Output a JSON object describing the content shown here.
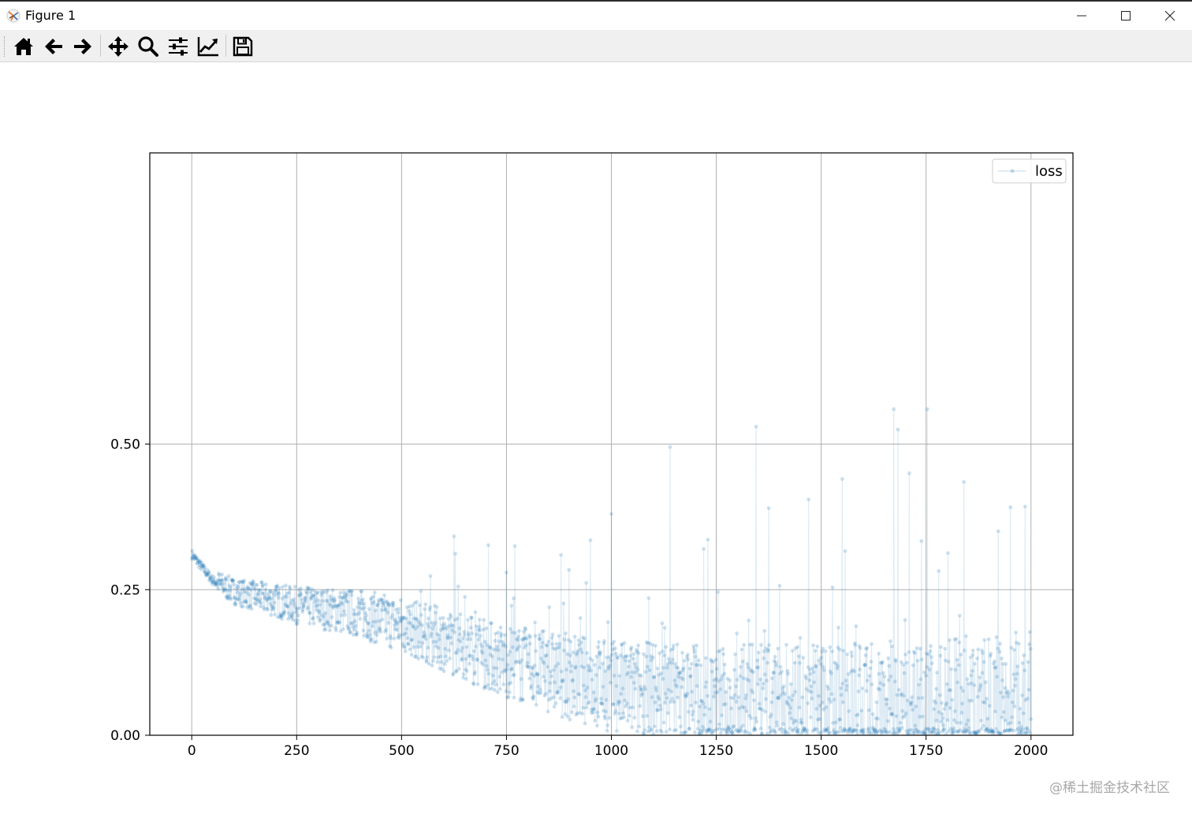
{
  "window": {
    "title": "Figure 1",
    "controls": [
      "minimize",
      "maximize",
      "close"
    ]
  },
  "toolbar": {
    "buttons": [
      {
        "name": "home",
        "icon": "home-icon"
      },
      {
        "name": "back",
        "icon": "arrow-left-icon"
      },
      {
        "name": "forward",
        "icon": "arrow-right-icon"
      },
      {
        "name": "pan",
        "icon": "move-icon"
      },
      {
        "name": "zoom",
        "icon": "magnifier-icon"
      },
      {
        "name": "subplots",
        "icon": "sliders-icon"
      },
      {
        "name": "customize",
        "icon": "line-chart-icon"
      },
      {
        "name": "save",
        "icon": "floppy-icon"
      }
    ]
  },
  "watermark": "@稀土掘金技术社区",
  "chart_data": {
    "type": "line",
    "title": "",
    "xlabel": "",
    "ylabel": "",
    "xlim": [
      -100,
      2100
    ],
    "ylim": [
      0,
      1.0
    ],
    "xticks": [
      "0",
      "250",
      "500",
      "750",
      "1000",
      "1250",
      "1500",
      "1750",
      "2000"
    ],
    "yticks": [
      "0.00",
      "0.25",
      "0.50"
    ],
    "grid": true,
    "legend": {
      "position": "top-right"
    },
    "series": [
      {
        "name": "loss",
        "color": "#1f77b4",
        "marker": "o",
        "alpha": 0.15,
        "n_points": 2001,
        "x_range": [
          0,
          2000
        ],
        "trend_points": [
          {
            "x": 0,
            "y": 0.31
          },
          {
            "x": 50,
            "y": 0.265
          },
          {
            "x": 100,
            "y": 0.245
          },
          {
            "x": 250,
            "y": 0.22
          },
          {
            "x": 400,
            "y": 0.205
          },
          {
            "x": 500,
            "y": 0.185
          },
          {
            "x": 750,
            "y": 0.12
          },
          {
            "x": 1000,
            "y": 0.075
          },
          {
            "x": 1250,
            "y": 0.05
          },
          {
            "x": 1500,
            "y": 0.035
          },
          {
            "x": 1750,
            "y": 0.025
          },
          {
            "x": 2000,
            "y": 0.02
          }
        ],
        "peaks": [
          {
            "x": 1140,
            "y": 0.495
          },
          {
            "x": 1345,
            "y": 0.53
          },
          {
            "x": 1673,
            "y": 0.56
          },
          {
            "x": 1683,
            "y": 0.525
          },
          {
            "x": 1753,
            "y": 0.56
          },
          {
            "x": 1550,
            "y": 0.44
          },
          {
            "x": 1840,
            "y": 0.435
          },
          {
            "x": 1710,
            "y": 0.45
          },
          {
            "x": 1000,
            "y": 0.38
          },
          {
            "x": 1470,
            "y": 0.405
          },
          {
            "x": 1375,
            "y": 0.39
          },
          {
            "x": 1220,
            "y": 0.32
          },
          {
            "x": 950,
            "y": 0.335
          },
          {
            "x": 770,
            "y": 0.325
          }
        ]
      }
    ]
  }
}
